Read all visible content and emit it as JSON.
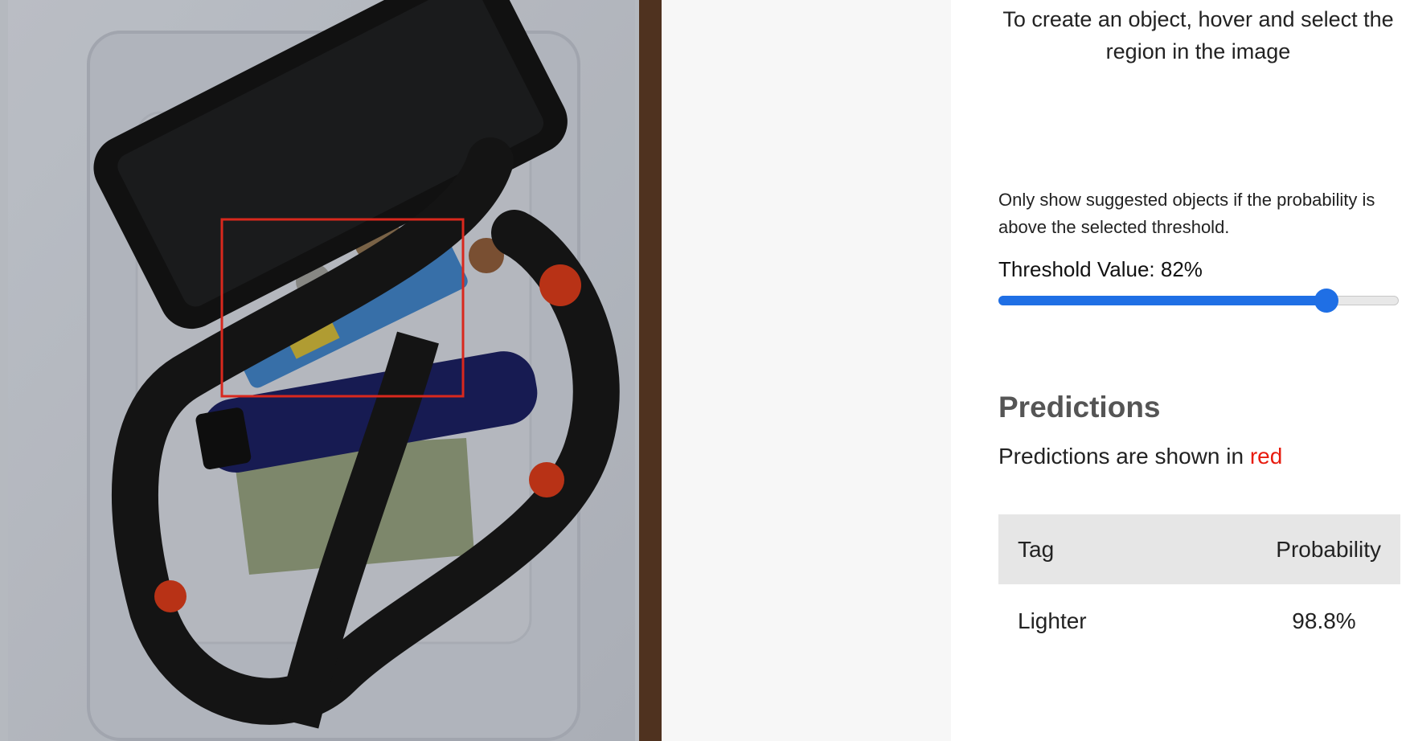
{
  "instructions": "To create an object, hover and select the region in the image",
  "threshold": {
    "description": "Only show suggested objects if the probability is above the selected threshold.",
    "label": "Threshold Value: 82%",
    "value_percent": 82
  },
  "predictions": {
    "title": "Predictions",
    "caption_prefix": "Predictions are shown in ",
    "caption_color_word": "red",
    "table": {
      "headers": [
        "Tag",
        "Probability"
      ],
      "rows": [
        {
          "tag": "Lighter",
          "probability": "98.8%"
        }
      ]
    }
  },
  "colors": {
    "accent": "#1f6fe5",
    "prediction": "#e81b0e"
  }
}
